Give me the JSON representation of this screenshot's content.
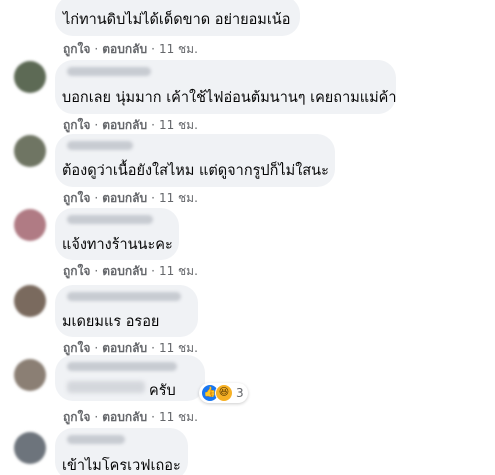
{
  "comments": [
    {
      "text": "ไก่ทานดิบไม่ได้เด็ดขาด อย่ายอมเน้อ",
      "like": "ถูกใจ",
      "reply": "ตอบกลับ",
      "time": "11 ชม."
    },
    {
      "text": "บอกเลย นุ่มมาก เค้าใช้ไฟอ่อนต้มนานๆ เคยถามแม่ค้า",
      "like": "ถูกใจ",
      "reply": "ตอบกลับ",
      "time": "11 ชม."
    },
    {
      "text": "ต้องดูว่าเนื้อยังใสไหม แต่ดูจากรูปก็ไม่ใสนะ",
      "like": "ถูกใจ",
      "reply": "ตอบกลับ",
      "time": "11 ชม."
    },
    {
      "text": "แจ้งทางร้านนะคะ",
      "like": "ถูกใจ",
      "reply": "ตอบกลับ",
      "time": "11 ชม."
    },
    {
      "text": "มเดยมแร อรอย",
      "like": "ถูกใจ",
      "reply": "ตอบกลับ",
      "time": "11 ชม."
    },
    {
      "text": "ครับ",
      "like": "ถูกใจ",
      "reply": "ตอบกลับ",
      "time": "11 ชม.",
      "reaction_count": "3",
      "reaction_icons": [
        "like-icon",
        "haha-icon"
      ]
    },
    {
      "text": "เข้าไมโครเวฟเถอะ"
    }
  ],
  "colors": {
    "bubble": "#f0f2f5",
    "text": "#050505",
    "meta": "#65676b",
    "like_blue": "#1877f2",
    "haha_yellow": "#f7b125"
  }
}
